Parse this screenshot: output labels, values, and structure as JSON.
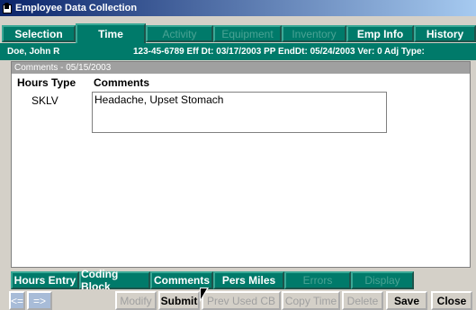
{
  "window": {
    "title": "Employee Data Collection"
  },
  "top_tabs": [
    {
      "label": "Selection",
      "state": "enabled"
    },
    {
      "label": "Time",
      "state": "active"
    },
    {
      "label": "Activity",
      "state": "disabled"
    },
    {
      "label": "Equipment",
      "state": "disabled"
    },
    {
      "label": "Inventory",
      "state": "disabled"
    },
    {
      "label": "Emp Info",
      "state": "enabled"
    },
    {
      "label": "History",
      "state": "enabled"
    }
  ],
  "infobar": {
    "employee_name": "Doe, John R",
    "details": "123-45-6789  Eff Dt: 03/17/2003  PP EndDt: 05/24/2003  Ver:  0  Adj Type:"
  },
  "panel": {
    "header": "Comments - 05/15/2003",
    "columns": [
      "Hours Type",
      "Comments"
    ],
    "rows": [
      {
        "hours_type": "SKLV",
        "comment": "Headache, Upset Stomach"
      }
    ]
  },
  "bottom_tabs": [
    {
      "label": "Hours Entry",
      "state": "enabled"
    },
    {
      "label": "Coding Block",
      "state": "enabled"
    },
    {
      "label": "Comments",
      "state": "active"
    },
    {
      "label": "Pers Miles",
      "state": "enabled"
    },
    {
      "label": "Errors",
      "state": "disabled"
    },
    {
      "label": "Display",
      "state": "disabled"
    }
  ],
  "buttons": {
    "prev": "<=",
    "next": "=>",
    "modify": "Modify",
    "submit": "Submit",
    "prev_used_cb": "Prev Used CB",
    "copy_time": "Copy Time",
    "delete": "Delete",
    "save": "Save",
    "close": "Close"
  },
  "colors": {
    "accent": "#007a6a",
    "titlebar": "#0a246a"
  }
}
